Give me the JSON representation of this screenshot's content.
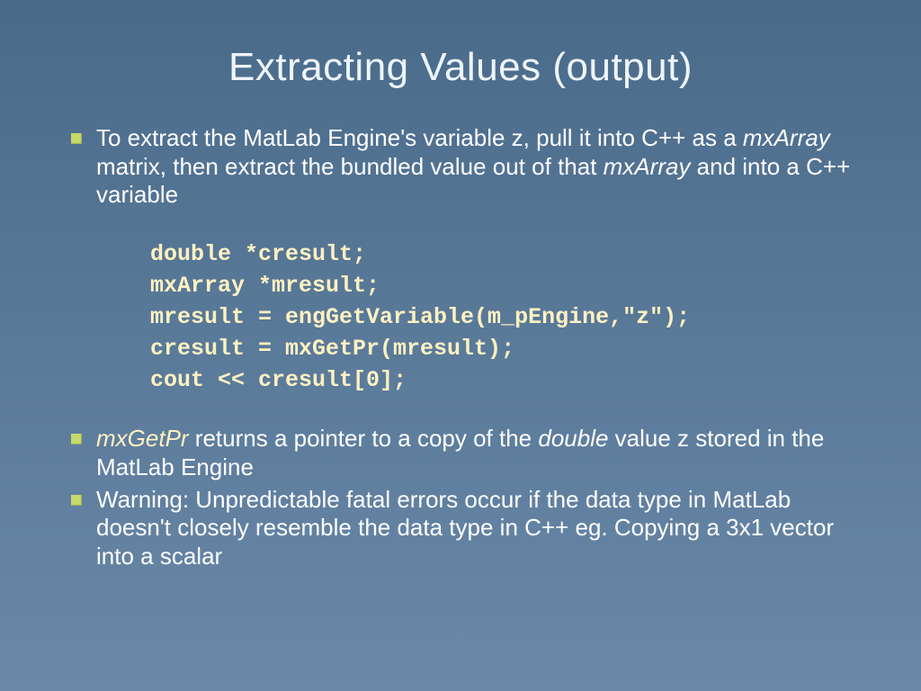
{
  "title": "Extracting Values (output)",
  "bullet1": {
    "pre": "To extract the MatLab Engine's variable z, pull it into C++ as a ",
    "em1": "mxArray",
    "mid1": " matrix, then extract the bundled value out of that ",
    "em2": "mxArray",
    "mid2": " and into a C++ variable"
  },
  "code": {
    "l1": "double *cresult;",
    "l2": "mxArray *mresult;",
    "l3": "mresult = engGetVariable(m_pEngine,\"z\");",
    "l4": "cresult = mxGetPr(mresult);",
    "l5": "cout << cresult[0];"
  },
  "bullet2": {
    "em1": "mxGetPr",
    "mid1": " returns a pointer to a copy of the ",
    "em2": "double",
    "mid2": " value z stored in the MatLab Engine"
  },
  "bullet3": "Warning: Unpredictable fatal errors occur if the data type in MatLab doesn't closely resemble the data type in C++ eg. Copying a 3x1 vector into a scalar"
}
